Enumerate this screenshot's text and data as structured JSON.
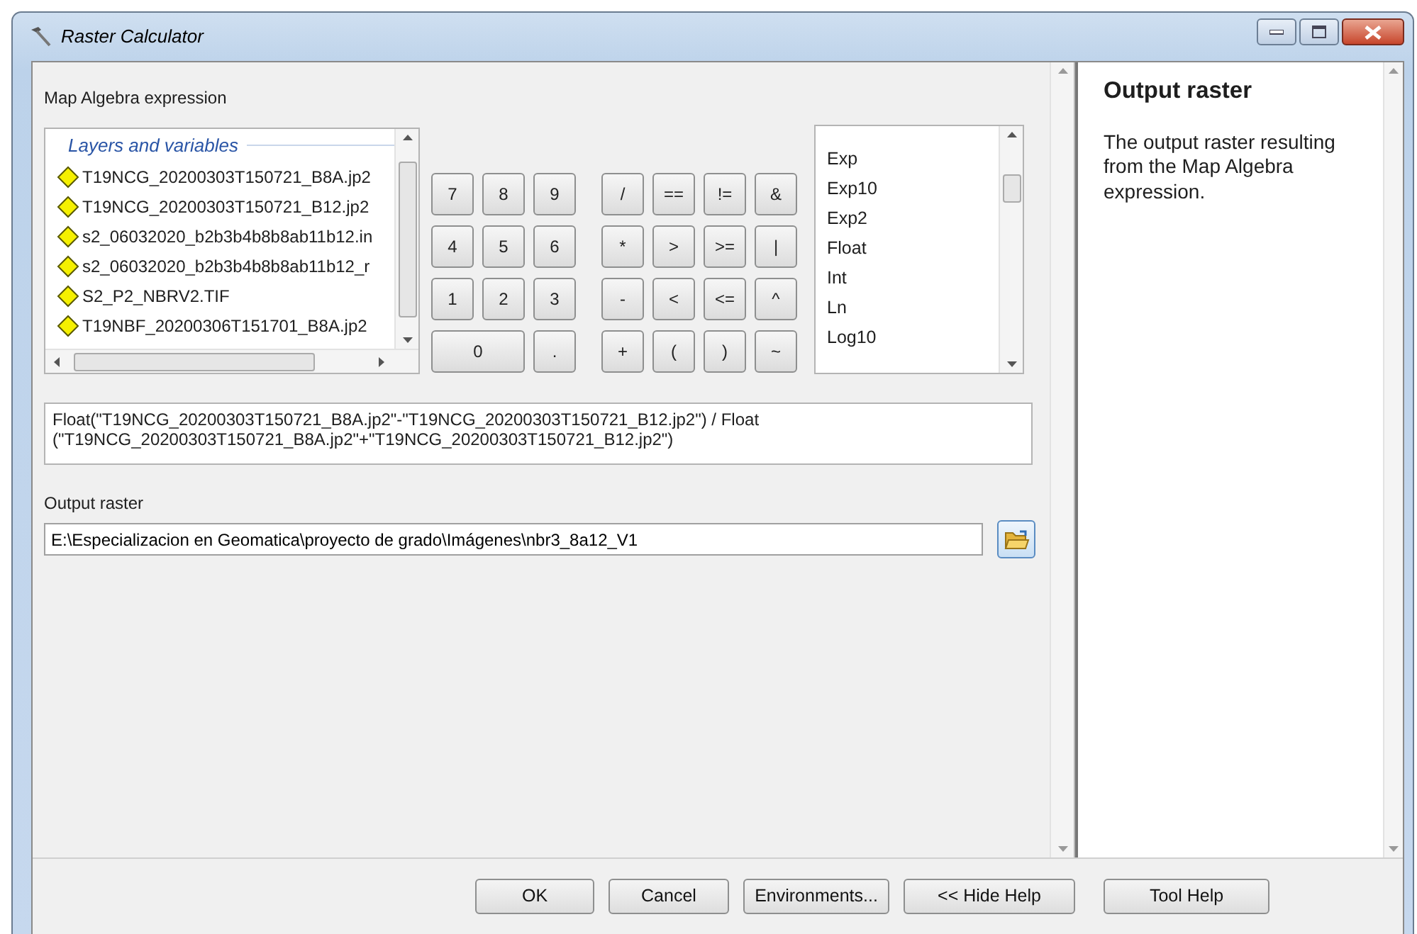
{
  "window": {
    "title": "Raster Calculator"
  },
  "expression_label": "Map Algebra expression",
  "layers": {
    "header": "Layers and variables",
    "items": [
      "T19NCG_20200303T150721_B8A.jp2",
      "T19NCG_20200303T150721_B12.jp2",
      "s2_06032020_b2b3b4b8b8ab11b12.in",
      "s2_06032020_b2b3b4b8b8ab11b12_r",
      "S2_P2_NBRV2.TIF",
      "T19NBF_20200306T151701_B8A.jp2"
    ]
  },
  "calculator_rows": [
    {
      "digits": [
        "7",
        "8",
        "9"
      ],
      "operators": [
        "/",
        "==",
        "!=",
        "&"
      ]
    },
    {
      "digits": [
        "4",
        "5",
        "6"
      ],
      "operators": [
        "*",
        ">",
        ">=",
        "|"
      ]
    },
    {
      "digits": [
        "1",
        "2",
        "3"
      ],
      "operators": [
        "-",
        "<",
        "<=",
        "^"
      ]
    },
    {
      "digits": [
        "0",
        "."
      ],
      "operators": [
        "+",
        "(",
        ")",
        "~"
      ]
    }
  ],
  "functions": [
    "Exp",
    "Exp10",
    "Exp2",
    "Float",
    "Int",
    "Ln",
    "Log10"
  ],
  "expression": "Float(\"T19NCG_20200303T150721_B8A.jp2\"-\"T19NCG_20200303T150721_B12.jp2\") / Float (\"T19NCG_20200303T150721_B8A.jp2\"+\"T19NCG_20200303T150721_B12.jp2\")",
  "output_raster": {
    "label": "Output raster",
    "value": "E:\\Especializacion en Geomatica\\proyecto de grado\\Imágenes\\nbr3_8a12_V1"
  },
  "buttons": [
    "OK",
    "Cancel",
    "Environments...",
    "<< Hide Help",
    "Tool Help"
  ],
  "help": {
    "title": "Output raster",
    "text": "The output raster resulting from the Map Algebra expression."
  }
}
